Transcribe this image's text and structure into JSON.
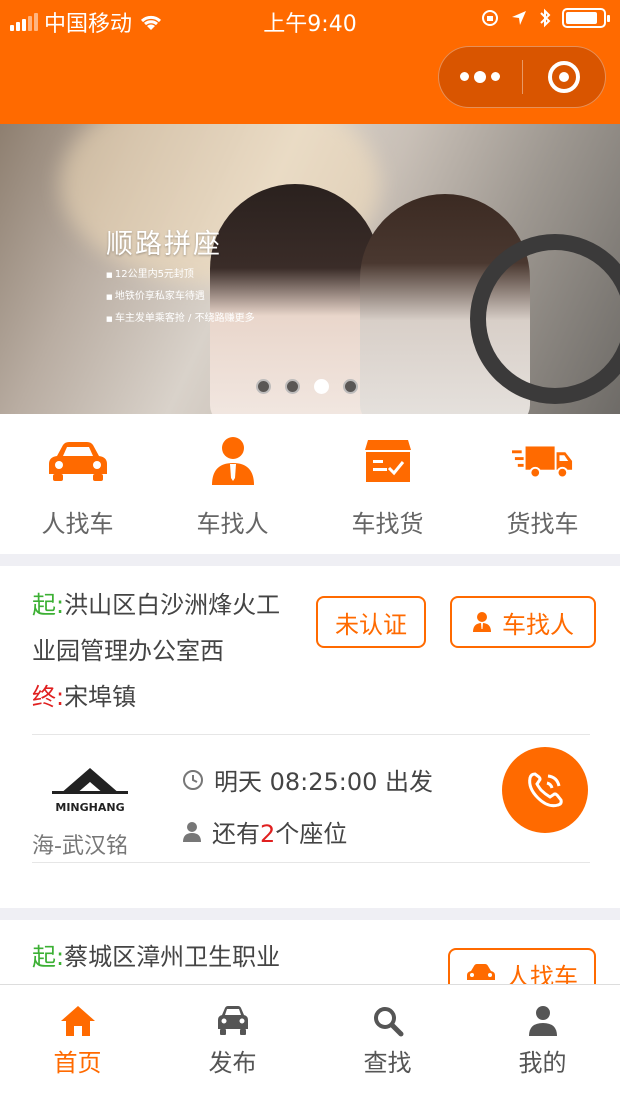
{
  "status_bar": {
    "carrier": "中国移动",
    "time": "上午9:40",
    "battery_level": 0.85
  },
  "header": {
    "capsule": {
      "more_icon": "more-dots-icon",
      "close_icon": "target-close-icon"
    }
  },
  "banner": {
    "title": "顺路拼座",
    "lines": [
      "12公里内5元封顶",
      "地铁价享私家车待遇",
      "车主发单乘客抢 / 不绕路赚更多"
    ],
    "slide_count": 4,
    "active_slide": 2
  },
  "categories": [
    {
      "label": "人找车",
      "icon": "car-icon"
    },
    {
      "label": "车找人",
      "icon": "person-icon"
    },
    {
      "label": "车找货",
      "icon": "cargo-box-icon"
    },
    {
      "label": "货找车",
      "icon": "truck-icon"
    }
  ],
  "listings": [
    {
      "start_tag": "起",
      "start_colon": ":",
      "start_line1": "洪山区白沙洲烽火工",
      "start_line2": "业园管理办公室西",
      "end_tag": "终",
      "end_colon": ":",
      "end": "宋埠镇",
      "badge": "未认证",
      "type_label": "车找人",
      "company": "海-武汉铭",
      "logo_text": "MINGHANG",
      "depart": "明天 08:25:00 出发",
      "seats_prefix": "还有",
      "seats_count": "2",
      "seats_suffix": "个座位"
    },
    {
      "start_tag": "起",
      "start_colon": ":",
      "start_line1": "蔡城区漳州卫生职业",
      "type_label": "人找车"
    }
  ],
  "tabbar": [
    {
      "label": "首页",
      "icon": "home-icon",
      "active": true
    },
    {
      "label": "发布",
      "icon": "car-front-icon",
      "active": false
    },
    {
      "label": "查找",
      "icon": "search-icon",
      "active": false
    },
    {
      "label": "我的",
      "icon": "user-icon",
      "active": false
    }
  ],
  "colors": {
    "brand": "#ff6a00",
    "start_green": "#3cb034",
    "end_red": "#e02020"
  }
}
